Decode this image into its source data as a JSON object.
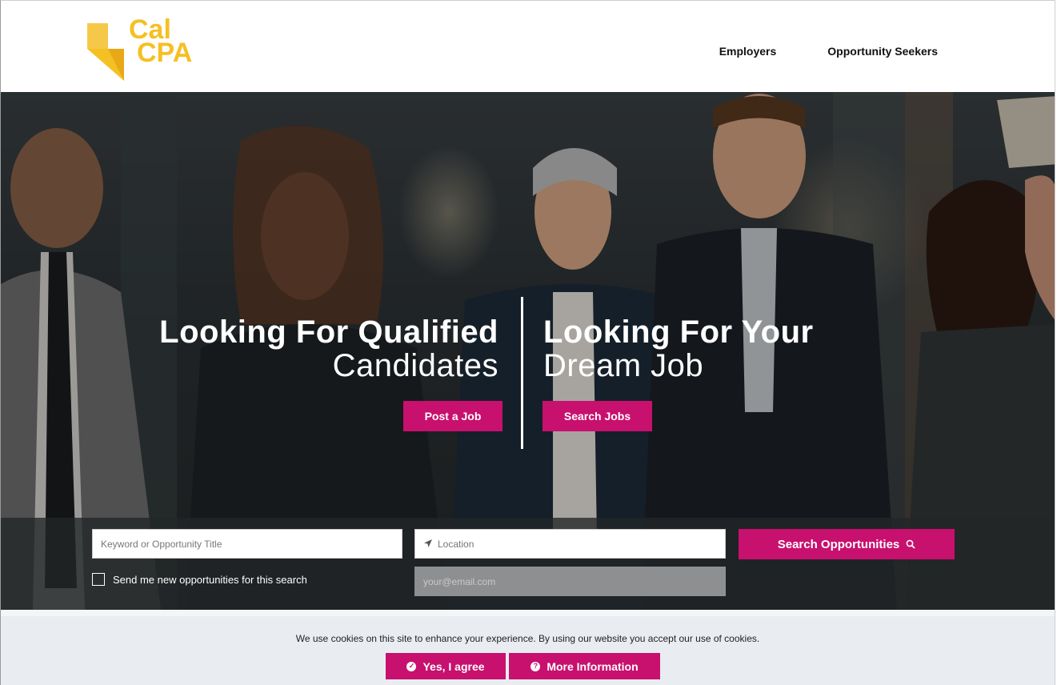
{
  "header": {
    "logo": {
      "line1": "Cal",
      "line2": "CPA"
    },
    "nav": [
      {
        "label": "Employers"
      },
      {
        "label": "Opportunity Seekers"
      }
    ]
  },
  "hero": {
    "left": {
      "bold": "Looking For Qualified",
      "thin": "Candidates",
      "button": "Post a Job"
    },
    "right": {
      "bold": "Looking For Your",
      "thin": "Dream Job",
      "button": "Search Jobs"
    }
  },
  "search": {
    "keyword_placeholder": "Keyword or Opportunity Title",
    "location_placeholder": "Location",
    "email_placeholder": "your@email.com",
    "checkbox_label": "Send me new opportunities for this search",
    "button_label": "Search Opportunities",
    "icons": {
      "location": "location-arrow-icon",
      "search": "search-icon"
    }
  },
  "cookie": {
    "text": "We use cookies on this site to enhance your experience. By using our website you accept our use of cookies.",
    "agree_label": "Yes, I agree",
    "more_label": "More Information"
  },
  "colors": {
    "accent": "#c8106e",
    "logo": "#f5c023"
  }
}
